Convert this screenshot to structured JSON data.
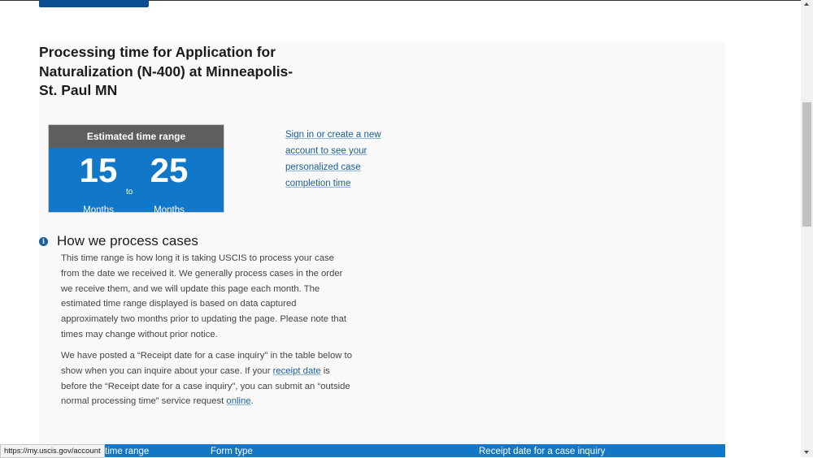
{
  "page": {
    "title": "Processing time for Application for Naturalization (N-400) at Minneapolis-St. Paul MN"
  },
  "time_range": {
    "header": "Estimated time range",
    "min": "15",
    "max": "25",
    "to": "to",
    "unit_min": "Months",
    "unit_max": "Months"
  },
  "signin": {
    "link_text": "Sign in or create a new account to see your personalized case completion time"
  },
  "how_we_process": {
    "heading": "How we process cases",
    "paragraph1": "This time range is how long it is taking USCIS to process your case from the date we received it. We generally process cases in the order we receive them, and we will update this page each month. The estimated time range displayed is based on data captured approximately two months prior to updating the page. Please note that times may change without prior notice.",
    "p2_part1": "We have posted a “Receipt date for a case inquiry\" in the table below to show when you can inquire about your case. If your ",
    "p2_link1": "receipt date",
    "p2_part2": " is before the “Receipt date for a case inquiry\", you can submit an “outside normal processing time” service request ",
    "p2_link2": "online",
    "p2_part3": "."
  },
  "table": {
    "columns": [
      "time range",
      "Form type",
      "Receipt date for a case inquiry"
    ]
  },
  "status_bar": {
    "url": "https://my.uscis.gov/account"
  },
  "icons": {
    "info": "info-icon"
  },
  "colors": {
    "primary": "#1077c9",
    "header_gray": "#5e5e5e",
    "link": "#1a5e9a"
  }
}
